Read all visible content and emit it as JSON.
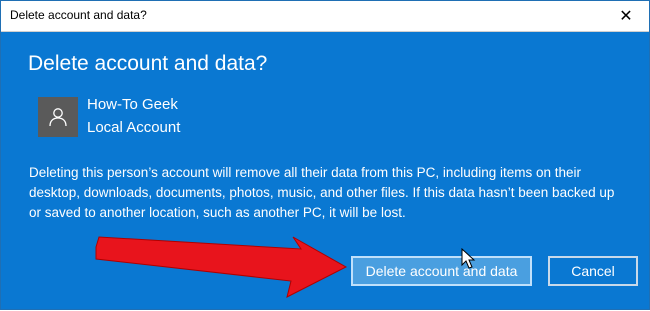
{
  "window": {
    "title": "Delete account and data?",
    "close_glyph": "✕"
  },
  "dialog": {
    "heading": "Delete account and data?",
    "account": {
      "icon": "user-icon",
      "name": "How-To Geek",
      "type": "Local Account"
    },
    "description": "Deleting this person’s account will remove all their data from this PC, including items on their desktop, downloads, documents, photos, music, and other files. If this data hasn’t been backed up or saved to another location, such as another PC, it will be lost.",
    "buttons": {
      "primary_label": "Delete account and data",
      "cancel_label": "Cancel"
    }
  },
  "colors": {
    "dialog_background": "#0a78d2",
    "primary_button": "#4a9fe0",
    "annotation_arrow": "#e8141c"
  }
}
